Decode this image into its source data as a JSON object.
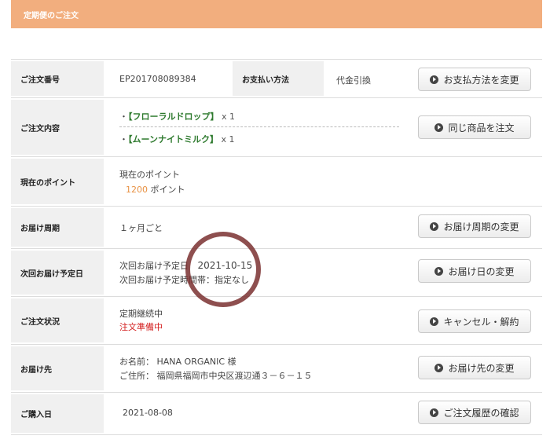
{
  "header": {
    "title": "定期便のご注文"
  },
  "rows": {
    "order_number": {
      "label": "ご注文番号",
      "value": "EP201708089384",
      "payment_label": "お支払い方法",
      "payment_value": "代金引換",
      "button": "お支払方法を変更"
    },
    "order_items": {
      "label": "ご注文内容",
      "items": [
        {
          "name": "【フローラルドロップ】",
          "qty": "x 1"
        },
        {
          "name": "【ムーンナイトミルク】",
          "qty": "x 1"
        }
      ],
      "bullet": "・",
      "button": "同じ商品を注文"
    },
    "points": {
      "label": "現在のポイント",
      "line1": "現在のポイント",
      "value": "1200",
      "unit": "ポイント"
    },
    "cycle": {
      "label": "お届け周期",
      "value": "１ヶ月ごと",
      "button": "お届け周期の変更"
    },
    "next_delivery": {
      "label": "次回お届け予定日",
      "date_label": "次回お届け予定日",
      "date_value": "2021-10-15",
      "time_label": "次回お届け予定時間帯：",
      "time_value": "指定なし",
      "button": "お届け日の変更"
    },
    "status": {
      "label": "ご注文状況",
      "line1": "定期継続中",
      "line2": "注文準備中",
      "button": "キャンセル・解約"
    },
    "destination": {
      "label": "お届け先",
      "name_line": "お名前： HANA ORGANIC  様",
      "address_line": "ご住所： 福岡県福岡市中央区渡辺通３－６－１５",
      "button": "お届け先の変更"
    },
    "purchase_date": {
      "label": "ご購入日",
      "value": "2021-08-08",
      "button": "ご注文履歴の確認"
    }
  },
  "colors": {
    "header": "#f2ae7e",
    "points": "#e89244",
    "status_red": "#d42020",
    "product_green": "#2e7a2e"
  }
}
